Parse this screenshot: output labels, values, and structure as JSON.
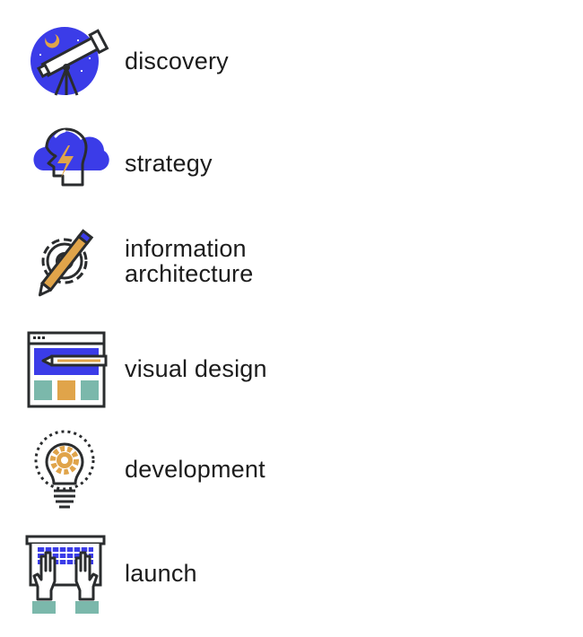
{
  "colors": {
    "blue": "#3b3ce8",
    "gold": "#e0a44a",
    "teal": "#7bb8ab",
    "ink": "#2a2c2e"
  },
  "steps": [
    {
      "icon": "telescope-icon",
      "label": "discovery"
    },
    {
      "icon": "head-lightning-cloud-icon",
      "label": "strategy"
    },
    {
      "icon": "gear-pencil-icon",
      "label_lines": [
        "information",
        "architecture"
      ]
    },
    {
      "icon": "browser-pencil-icon",
      "label": "visual design"
    },
    {
      "icon": "lightbulb-gear-icon",
      "label": "development"
    },
    {
      "icon": "laptop-hands-icon",
      "label": "launch"
    }
  ]
}
